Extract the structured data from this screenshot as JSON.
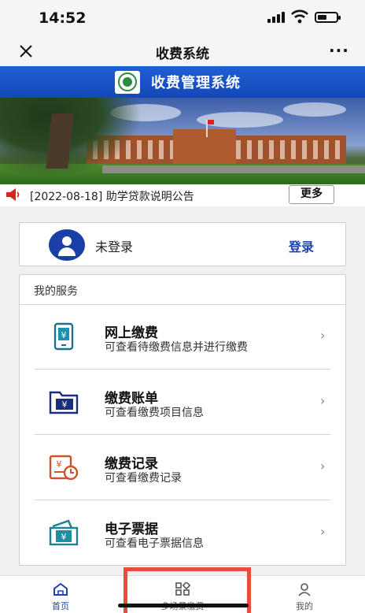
{
  "status_bar": {
    "time": "14:52"
  },
  "nav": {
    "title": "收费系统",
    "close_icon": "close-icon",
    "more": "···"
  },
  "header": {
    "title": "收费管理系统",
    "logo": "school-logo"
  },
  "notice": {
    "icon": "speaker-icon",
    "text": "[2022-08-18] 助学贷款说明公告",
    "more_label": "更多"
  },
  "login": {
    "status": "未登录",
    "action": "登录"
  },
  "services": {
    "title": "我的服务",
    "items": [
      {
        "name": "网上缴费",
        "desc": "可查看待缴费信息并进行缴费",
        "icon": "mobile-payment-icon"
      },
      {
        "name": "缴费账单",
        "desc": "可查看缴费项目信息",
        "icon": "bill-folder-icon"
      },
      {
        "name": "缴费记录",
        "desc": "可查看缴费记录",
        "icon": "payment-record-icon"
      },
      {
        "name": "电子票据",
        "desc": "可查看电子票据信息",
        "icon": "e-receipt-icon"
      }
    ]
  },
  "tabs": [
    {
      "label": "首页",
      "icon": "home-icon",
      "active": true
    },
    {
      "label": "多场景缴费",
      "icon": "grid-icon",
      "active": false
    },
    {
      "label": "我的",
      "icon": "user-icon",
      "active": false
    }
  ],
  "colors": {
    "brand_blue": "#1a44b0",
    "header_blue": "#1d5fd4",
    "highlight_red": "#e84c3d",
    "icon_teal": "#1d7f8f",
    "icon_orange": "#c9562a"
  }
}
